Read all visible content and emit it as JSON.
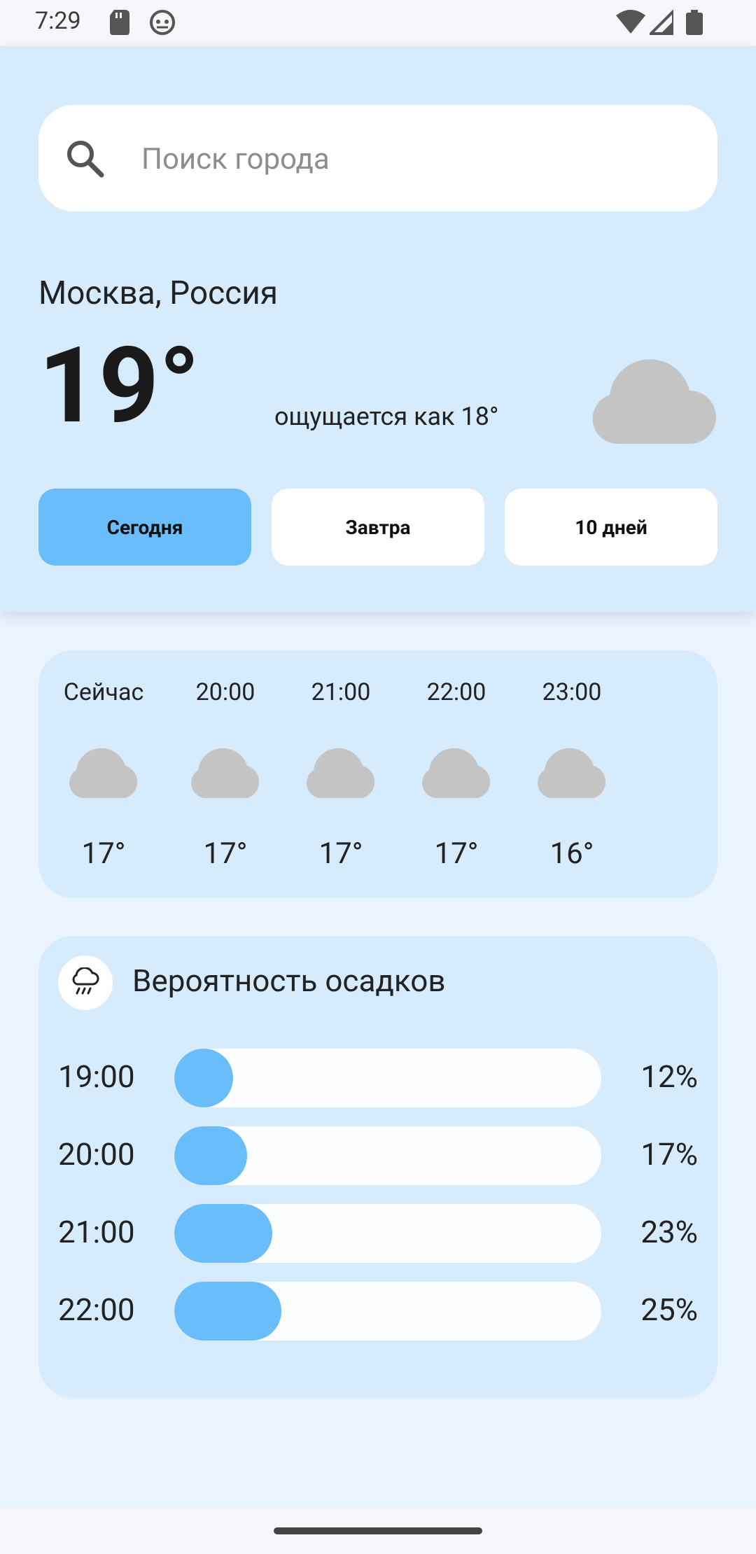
{
  "status": {
    "time": "7:29"
  },
  "search": {
    "placeholder": "Поиск города"
  },
  "weather": {
    "city": "Москва, Россия",
    "temp": "19°",
    "feels_like": "ощущается как 18°"
  },
  "tabs": [
    {
      "label": "Сегодня",
      "active": true
    },
    {
      "label": "Завтра",
      "active": false
    },
    {
      "label": "10 дней",
      "active": false
    }
  ],
  "hourly": [
    {
      "time": "Сейчас",
      "temp": "17°",
      "icon": "cloud-icon"
    },
    {
      "time": "20:00",
      "temp": "17°",
      "icon": "cloud-icon"
    },
    {
      "time": "21:00",
      "temp": "17°",
      "icon": "cloud-icon"
    },
    {
      "time": "22:00",
      "temp": "17°",
      "icon": "cloud-icon"
    },
    {
      "time": "23:00",
      "temp": "16°",
      "icon": "cloud-icon"
    }
  ],
  "precipitation": {
    "title": "Вероятность осадков",
    "icon": "rain-cloud-icon",
    "rows": [
      {
        "time": "19:00",
        "value": "12%",
        "fraction": 0.12
      },
      {
        "time": "20:00",
        "value": "17%",
        "fraction": 0.17
      },
      {
        "time": "21:00",
        "value": "23%",
        "fraction": 0.23
      },
      {
        "time": "22:00",
        "value": "25%",
        "fraction": 0.25
      }
    ]
  },
  "colors": {
    "accent": "#6abdfb",
    "header_bg": "#d6ebfc",
    "page_bg": "#eaf4fe",
    "cloud": "#c4c4c4"
  }
}
